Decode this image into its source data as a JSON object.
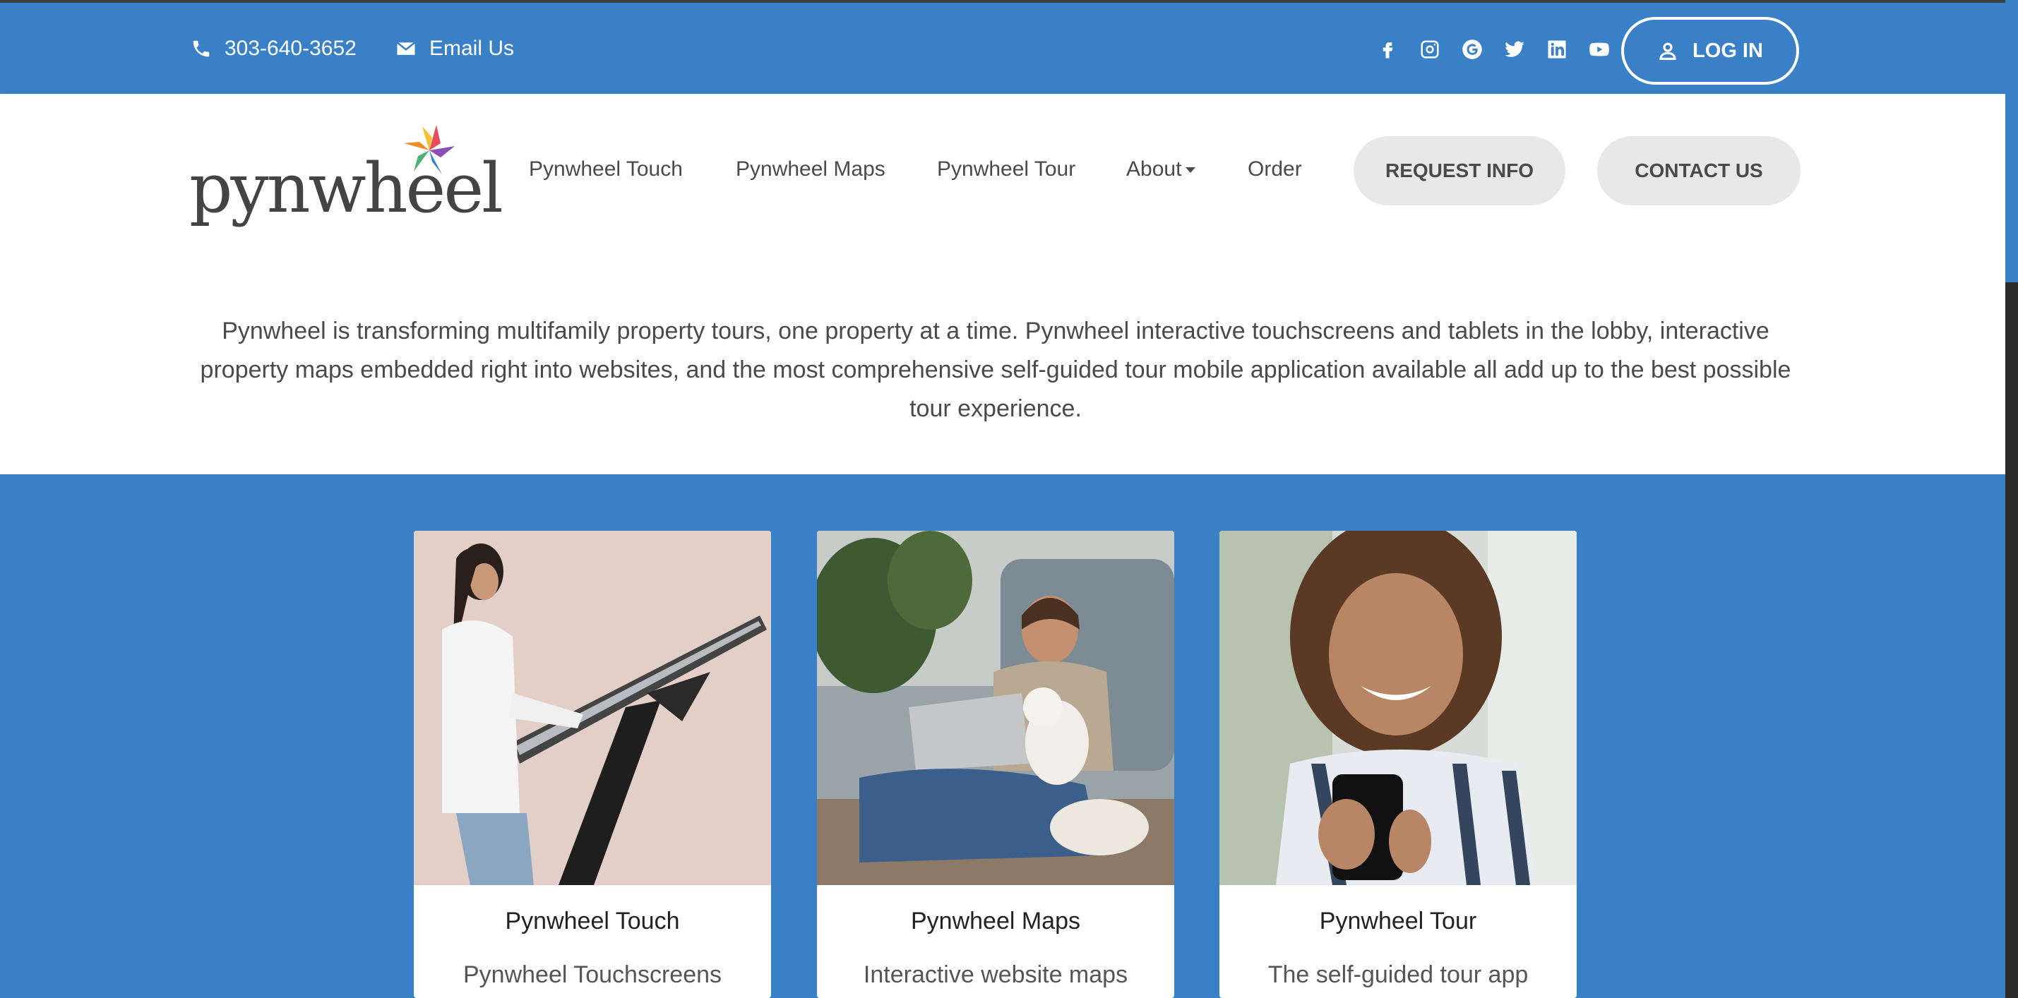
{
  "topbar": {
    "phone": "303-640-3652",
    "email_label": "Email Us",
    "login_label": "LOG IN",
    "socials": [
      "facebook-icon",
      "instagram-icon",
      "google-icon",
      "twitter-icon",
      "linkedin-icon",
      "youtube-icon"
    ]
  },
  "nav": {
    "logo_text": "pynwheel",
    "links": [
      "Pynwheel Touch",
      "Pynwheel Maps",
      "Pynwheel Tour",
      "About",
      "Order"
    ],
    "request_info_label": "REQUEST INFO",
    "contact_us_label": "CONTACT US"
  },
  "intro": {
    "text": "Pynwheel is transforming multifamily property tours, one property at a time. Pynwheel interactive touchscreens and tablets in the lobby, interactive property maps embedded right into websites, and the most comprehensive self-guided tour mobile application available all add up to the best possible tour experience."
  },
  "cards": [
    {
      "title": "Pynwheel Touch",
      "text": "Pynwheel Touchscreens"
    },
    {
      "title": "Pynwheel Maps",
      "text": "Interactive website maps"
    },
    {
      "title": "Pynwheel Tour",
      "text": "The self-guided tour app"
    }
  ],
  "colors": {
    "brand_blue": "#3a80c6",
    "pill_gray": "#e8e8e8",
    "text_gray": "#4a4a4a"
  }
}
